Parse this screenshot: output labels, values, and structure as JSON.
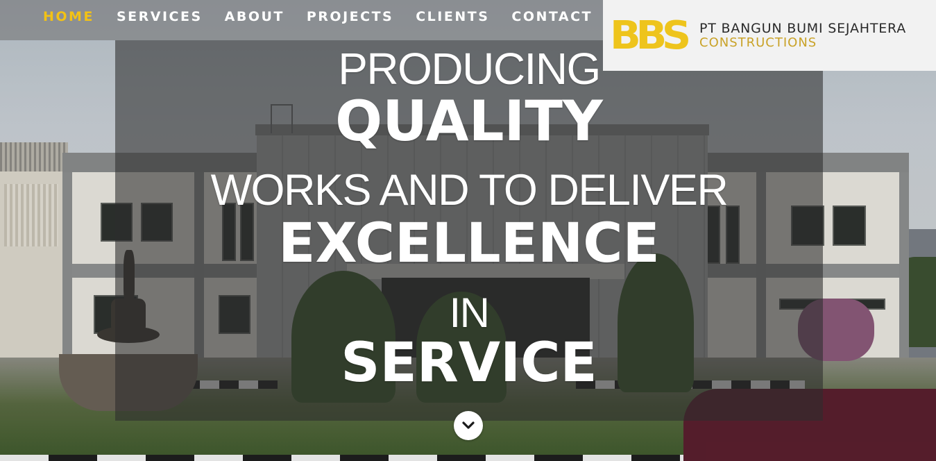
{
  "nav": {
    "items": [
      {
        "label": "HOME",
        "active": true
      },
      {
        "label": "SERVICES",
        "active": false
      },
      {
        "label": "ABOUT",
        "active": false
      },
      {
        "label": "PROJECTS",
        "active": false
      },
      {
        "label": "CLIENTS",
        "active": false
      },
      {
        "label": "CONTACT",
        "active": false
      }
    ],
    "active_color": "#f3c214",
    "text_color": "#ffffff"
  },
  "logo": {
    "mark": "BBS",
    "company": "PT BANGUN BUMI SEJAHTERA",
    "subtitle": "CONSTRUCTIONS",
    "mark_color": "#eec41c",
    "subtitle_color": "#c9a227"
  },
  "hero": {
    "lines": [
      "PRODUCING",
      "QUALITY",
      "WORKS AND TO DELIVER",
      "EXCELLENCE",
      "IN",
      "SERVICE"
    ],
    "scroll_icon": "chevron-down-icon"
  }
}
